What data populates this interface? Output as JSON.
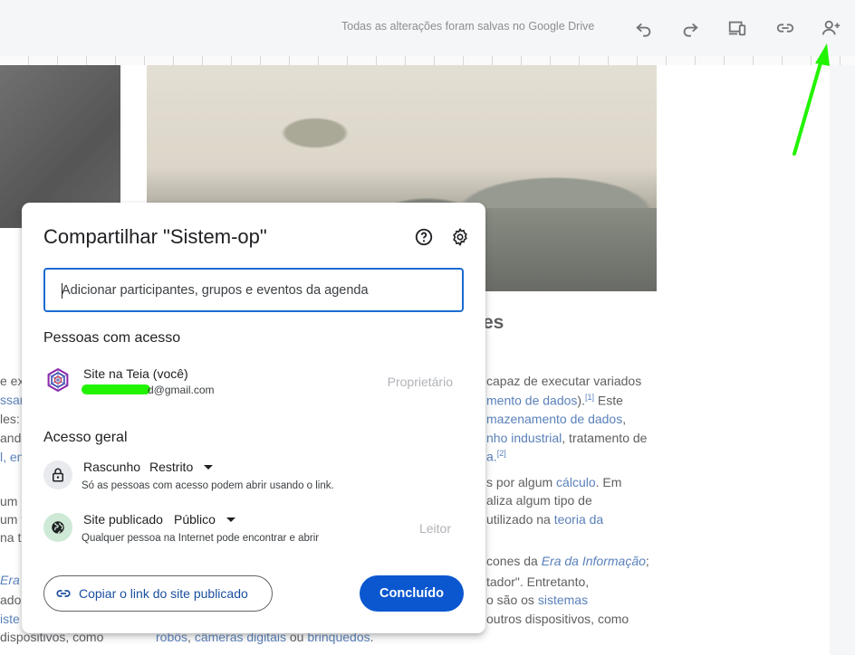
{
  "toolbar": {
    "save_status": "Todas as alterações foram salvas no Google Drive",
    "icons": [
      "undo-icon",
      "redo-icon",
      "preview-icon",
      "link-icon",
      "share-icon"
    ]
  },
  "background": {
    "heading_fragment": "es",
    "lines": [
      {
        "left": "e ex",
        "right": "capaz de executar variados"
      },
      {
        "left": "ssar",
        "right_link": "mento de dados",
        "right_after": ").",
        "sup": "[1]",
        "right_tail": " Este"
      },
      {
        "left": "les:",
        "right_link": "mazenamento de dados",
        "right_after": ","
      },
      {
        "left": "ande",
        "right_link": "nho industrial",
        "right_after": ", tratamento de"
      },
      {
        "left": "l, en",
        "right_link": "a.",
        "sup": "[2]"
      },
      {
        "left": "um",
        "right_pre": "s por algum ",
        "right_link": "cálculo",
        "right_after": ". Em"
      },
      {
        "left": "um t",
        "right": "aliza algum tipo de"
      },
      {
        "left": "na t",
        "right_pre": "utilizado na ",
        "right_link": "teoria da"
      },
      {
        "left": "Era",
        "right_pre": "cones da ",
        "right_italic": "Era da Informação",
        "right_after": ";"
      },
      {
        "left": "ado",
        "right": "tador\". Entretanto,"
      },
      {
        "left": "iste",
        "right_pre": "o são os ",
        "right_link": "sistemas"
      },
      {
        "left": "dispositivos, como",
        "right": "outros dispositivos, como"
      },
      {
        "bottom_link1": "robôs",
        "bottom_sep": ", ",
        "bottom_link2": "câmeras digitais",
        "bottom_mid": " ou ",
        "bottom_link3": "brinquedos",
        "bottom_end": "."
      }
    ]
  },
  "dialog": {
    "title": "Compartilhar \"Sistem-op\"",
    "input_placeholder": "Adicionar participantes, grupos e eventos da agenda",
    "people_section": "Pessoas com acesso",
    "person": {
      "name": "Site na Teia (você)",
      "email_suffix": "d@gmail.com",
      "role": "Proprietário"
    },
    "general_section": "Acesso geral",
    "draft": {
      "label": "Rascunho",
      "value": "Restrito",
      "description": "Só as pessoas com acesso podem abrir usando o link."
    },
    "published": {
      "label": "Site publicado",
      "value": "Público",
      "description": "Qualquer pessoa na Internet pode encontrar e abrir",
      "role": "Leitor"
    },
    "copy_link_label": "Copiar o link do site publicado",
    "done_label": "Concluído"
  },
  "colors": {
    "primary": "#0b57d0",
    "link": "#1a4fa0",
    "annotation_arrow": "#22f400"
  }
}
